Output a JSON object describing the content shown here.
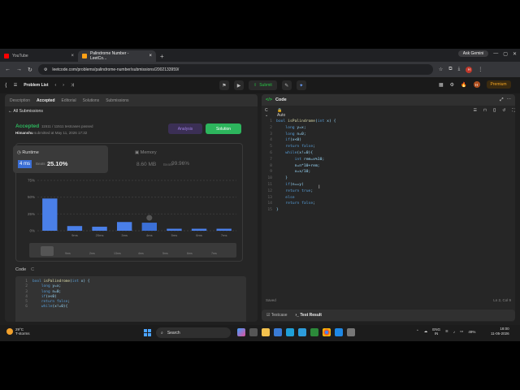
{
  "browser": {
    "tabs": [
      {
        "title": "YouTube",
        "color": "#ff0000"
      },
      {
        "title": "Palindrome Number - LeetCo...",
        "color": "#ffa116"
      }
    ],
    "gemini": "Ask Gemini",
    "url": "leetcode.com/problems/palindrome-number/submissions/2002133959/"
  },
  "lc_header": {
    "problem_list": "Problem List",
    "submit": "Submit",
    "premium": "Premium"
  },
  "left": {
    "tabs": [
      "Description",
      "Accepted",
      "Editorial",
      "Solutions",
      "Submissions"
    ],
    "all_submissions": "All Submissions",
    "status": "Accepted",
    "testcases": "11511 / 11511 testcases passed",
    "author": "Himanshu",
    "submitted": "submitted at May 11, 2026 17:32",
    "analysis": "Analysis",
    "solution": "Solution",
    "runtime_label": "Runtime",
    "runtime_value": "4 ms",
    "beats": "Beats",
    "runtime_beats": "25.10%",
    "memory_label": "Memory",
    "memory_value": "8.60 MB",
    "memory_beats": "99.96%",
    "code_label": "Code",
    "code_lang": "C",
    "code_lines": [
      "bool isPalindrome(int x) {",
      "    long y=x;",
      "    long n=0;",
      "    if(x<0)",
      "    return false;",
      "    while(x!=0){"
    ]
  },
  "chart_data": {
    "type": "bar",
    "yticks": [
      "75%",
      "50%",
      "25%",
      "0%"
    ],
    "ylim": [
      0,
      75
    ],
    "categories": [
      "0ms",
      "1ms",
      "2ms",
      "3ms",
      "4ms",
      "5ms",
      "6ms",
      "7ms"
    ],
    "xlabels": [
      "",
      "9ms",
      "20ms",
      "3ms",
      "4ms",
      "5ms",
      "6ms",
      "7ms"
    ],
    "values": [
      48,
      7,
      6,
      13,
      12,
      3,
      3,
      3
    ],
    "highlight_index": 4,
    "minimap_labels": [
      "9ms",
      "2ms",
      "13ms",
      "4ms",
      "5ms",
      "6ms",
      "7ms"
    ]
  },
  "right": {
    "title": "Code",
    "lang": "C",
    "mode": "Auto",
    "lines": [
      "bool isPalindrome(int x) {",
      "    long y=x;",
      "    long n=0;",
      "    if(x<0)",
      "    return false;",
      "    while(x!=0){",
      "        int rem=x%10;",
      "        n=n*10+rem;",
      "        x=x/10;",
      "    }",
      "    if(n==y)",
      "    return true;",
      "    else",
      "    return false;",
      "}"
    ],
    "saved": "Saved",
    "position": "Ln 2, Col 9",
    "bottom_tabs": [
      "Testcase",
      "Test Result"
    ]
  },
  "taskbar": {
    "temp": "29°C",
    "weather": "T-storms",
    "search": "Search",
    "lang": "ENG",
    "region": "IN",
    "battery": "49%",
    "time": "18:00",
    "date": "11-05-2026"
  }
}
